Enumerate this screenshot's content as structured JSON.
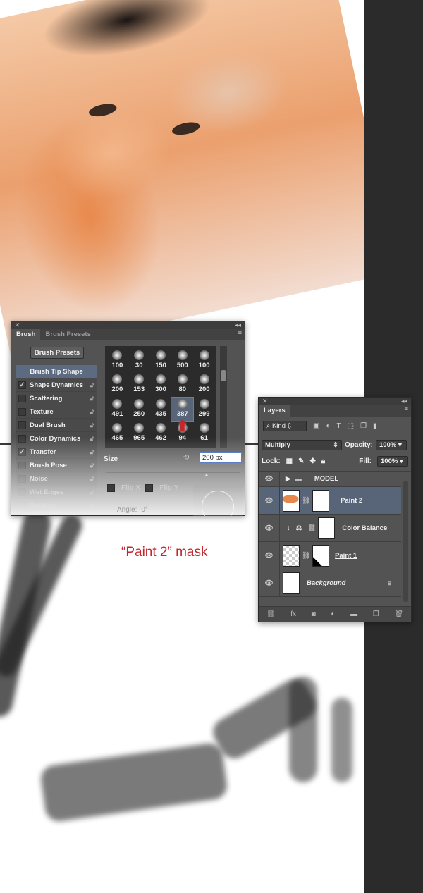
{
  "caption": "“Paint 2” mask",
  "brush_panel": {
    "tabs": [
      "Brush",
      "Brush Presets"
    ],
    "presets_button": "Brush Presets",
    "options": [
      {
        "label": "Brush Tip Shape",
        "checked": null
      },
      {
        "label": "Shape Dynamics",
        "checked": true
      },
      {
        "label": "Scattering",
        "checked": false
      },
      {
        "label": "Texture",
        "checked": false
      },
      {
        "label": "Dual Brush",
        "checked": false
      },
      {
        "label": "Color Dynamics",
        "checked": false
      },
      {
        "label": "Transfer",
        "checked": true
      },
      {
        "label": "Brush Pose",
        "checked": false
      },
      {
        "label": "Noise",
        "checked": false
      },
      {
        "label": "Wet Edges",
        "checked": false
      },
      {
        "label": "Build-up",
        "checked": false
      }
    ],
    "brush_sizes": [
      "100",
      "30",
      "150",
      "500",
      "100",
      "200",
      "153",
      "300",
      "80",
      "200",
      "491",
      "250",
      "435",
      "387",
      "299",
      "465",
      "965",
      "462",
      "94",
      "61"
    ],
    "selected_brush": "387",
    "size_label": "Size",
    "size_value": "200 px",
    "flip_x": "Flip X",
    "flip_y": "Flip Y",
    "angle_label": "Angle:",
    "angle_value": "0°"
  },
  "layers_panel": {
    "tab": "Layers",
    "filter": "Kind",
    "blend_mode": "Multiply",
    "opacity_label": "Opacity:",
    "opacity": "100%",
    "lock_label": "Lock:",
    "fill_label": "Fill:",
    "fill": "100%",
    "layers": [
      {
        "name": "MODEL",
        "type": "group"
      },
      {
        "name": "Paint 2",
        "selected": true
      },
      {
        "name": "Color Balance",
        "type": "adjustment"
      },
      {
        "name": "Paint 1"
      },
      {
        "name": "Background",
        "locked": true
      }
    ]
  }
}
